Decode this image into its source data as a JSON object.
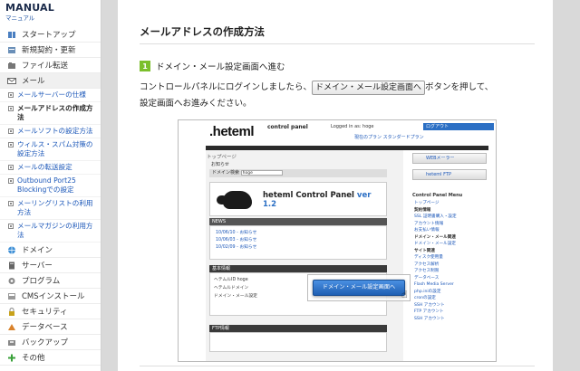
{
  "brand": {
    "title": "MANUAL",
    "subtitle": "マニュアル"
  },
  "sidebar": {
    "items_top": [
      {
        "label": "スタートアップ",
        "icon": "book-icon"
      },
      {
        "label": "新規契約・更新",
        "icon": "contract-icon"
      },
      {
        "label": "ファイル転送",
        "icon": "file-icon"
      },
      {
        "label": "メール",
        "icon": "mail-icon"
      }
    ],
    "sub_items": [
      {
        "label": "メールサーバーの仕様"
      },
      {
        "label": "メールアドレスの作成方法"
      },
      {
        "label": "メールソフトの設定方法"
      },
      {
        "label": "ウィルス・スパム対策の設定方法"
      },
      {
        "label": "メールの転送設定"
      },
      {
        "label": "Outbound Port25 Blockingでの設定"
      },
      {
        "label": "メーリングリストの利用方法"
      },
      {
        "label": "メールマガジンの利用方法"
      }
    ],
    "items_bottom": [
      {
        "label": "ドメイン",
        "icon": "globe-icon"
      },
      {
        "label": "サーバー",
        "icon": "server-icon"
      },
      {
        "label": "プログラム",
        "icon": "program-icon"
      },
      {
        "label": "CMSインストール",
        "icon": "cms-icon"
      },
      {
        "label": "セキュリティ",
        "icon": "lock-icon"
      },
      {
        "label": "データベース",
        "icon": "database-icon"
      },
      {
        "label": "バックアップ",
        "icon": "backup-icon"
      },
      {
        "label": "その他",
        "icon": "plus-icon"
      }
    ]
  },
  "main": {
    "title": "メールアドレスの作成方法",
    "step": {
      "number": "1",
      "text": "ドメイン・メール設定画面へ進む"
    },
    "body_before": "コントロールパネルにログインしましたら、",
    "button_label": "ドメイン・メール設定画面へ",
    "body_after": "ボタンを押して、",
    "body_line2": "設定画面へお進みください。"
  },
  "screenshot": {
    "logo": ".heteml",
    "logo_cp": "control panel",
    "logged_in": "Logged in as: hoge",
    "biz_link": "ログアウト",
    "small_links": "現在のプラン スタンダードプラン",
    "tab": "トップページ",
    "notice": "お知らせ",
    "domain_label": "ドメイン検索",
    "domain_value": "hoge",
    "banner_title": "heteml Control Panel",
    "banner_version": "ver 1.2",
    "news_head": "NEWS",
    "news_items": [
      "10/06/10 - お知らせ",
      "10/06/03 - お知らせ",
      "10/02/09 - お知らせ"
    ],
    "info_head": "基本情報",
    "info_rows": [
      "ヘテムルID    hoge",
      "ヘテムルドメイン",
      "ドメイン・メール設定"
    ],
    "ftp_head": "FTP情報",
    "right_buttons": [
      "WEBメーラー",
      "heteml FTP"
    ],
    "menu_head": "Control Panel Menu",
    "menu_items": [
      "トップページ",
      "契約情報",
      "SSL 証明書購入・設定",
      "アカウント情報",
      "お支払い情報",
      "ドメイン・メール関連",
      "ドメイン・メール設定",
      "サイト関連",
      "ディスク使用量",
      "アクセス解析",
      "アクセス制限",
      "データベース",
      "Flash Media Server",
      "php.iniの設定",
      "cronの設定",
      "SSH アカウント",
      "FTP アカウント",
      "SSH アカウント"
    ],
    "popup_button": "ドメイン・メール設定画面へ"
  }
}
